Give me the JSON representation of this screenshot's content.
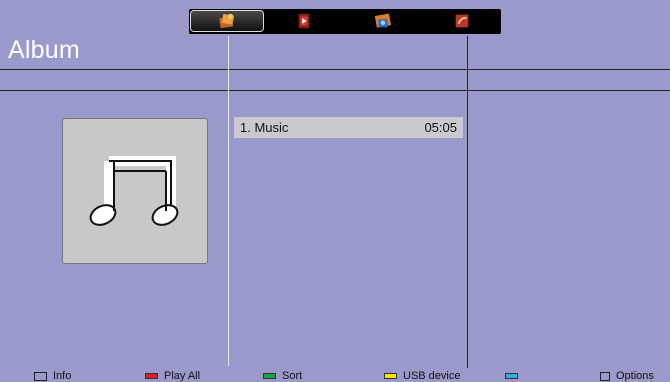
{
  "tabs": [
    {
      "name": "all-media-icon",
      "active": true
    },
    {
      "name": "video-icon",
      "active": false
    },
    {
      "name": "photo-icon",
      "active": false
    },
    {
      "name": "music-icon",
      "active": false
    }
  ],
  "header": {
    "title": "Album"
  },
  "tracks": [
    {
      "title": "1. Music",
      "duration": "05:05"
    }
  ],
  "footer": {
    "info": "Info",
    "play_all": "Play All",
    "sort": "Sort",
    "usb_device": "USB device",
    "options": "Options"
  },
  "colors": {
    "background": "#9a99cb",
    "red": "#e01b24",
    "green": "#1aa547",
    "yellow": "#f5e400",
    "blue": "#2bb0e8"
  }
}
